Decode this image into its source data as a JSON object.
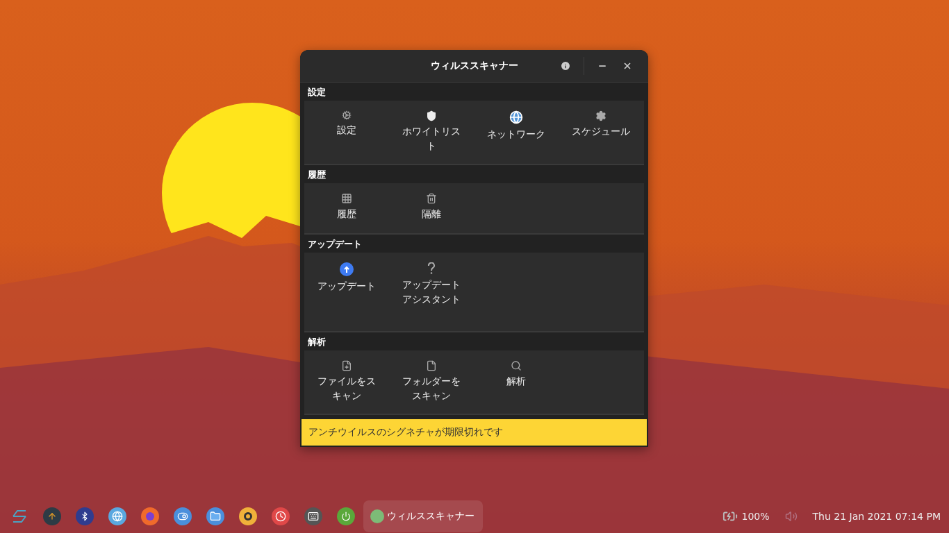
{
  "window": {
    "title": "ウィルススキャナー"
  },
  "sections": [
    {
      "title": "設定",
      "items": [
        {
          "label": "設定"
        },
        {
          "label": "ホワイトリスト"
        },
        {
          "label": "ネットワーク"
        },
        {
          "label": "スケジュール"
        }
      ]
    },
    {
      "title": "履歴",
      "items": [
        {
          "label": "履歴"
        },
        {
          "label": "隔離"
        }
      ]
    },
    {
      "title": "アップデート",
      "items": [
        {
          "label": "アップデート"
        },
        {
          "label": "アップデートアシスタント"
        }
      ]
    },
    {
      "title": "解析",
      "items": [
        {
          "label": "ファイルをスキャン"
        },
        {
          "label": "フォルダーをスキャン"
        },
        {
          "label": "解析"
        }
      ]
    }
  ],
  "status_message": "アンチウイルスのシグネチャが期限切れです",
  "taskbar": {
    "active_app": "ウィルススキャナー"
  },
  "tray": {
    "battery": "100%",
    "clock": "Thu 21 Jan 2021 07:14 PM"
  }
}
